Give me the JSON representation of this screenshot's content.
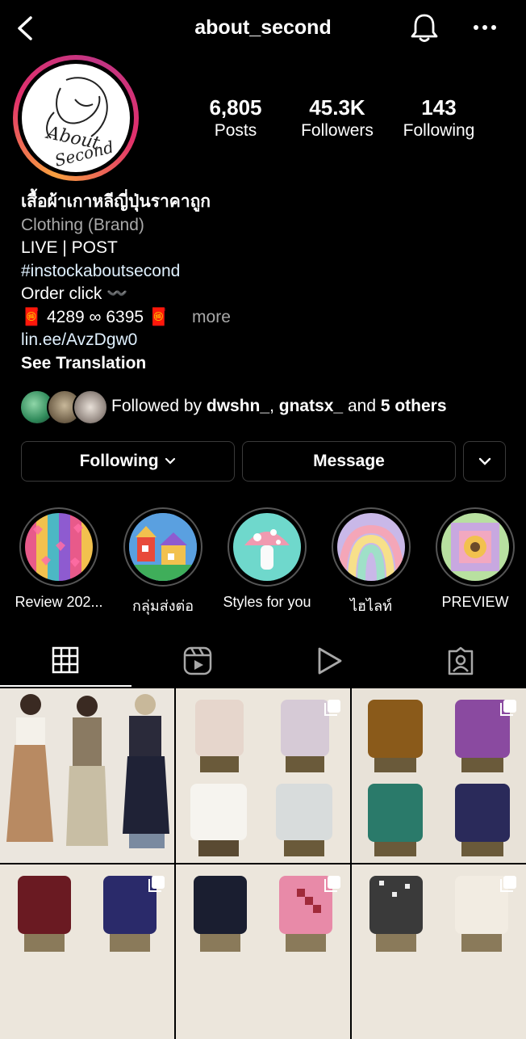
{
  "header": {
    "title": "about_second",
    "back_icon": "chevron-left-icon",
    "bell_icon": "bell-icon",
    "menu_icon": "more-horizontal-icon"
  },
  "avatar": {
    "logo_text": "About Second"
  },
  "stats": [
    {
      "num": "6,805",
      "label": "Posts"
    },
    {
      "num": "45.3K",
      "label": "Followers"
    },
    {
      "num": "143",
      "label": "Following"
    }
  ],
  "bio": {
    "name": "เสื้อผ้าเกาหลีญี่ปุ่นราคาถูก",
    "category": "Clothing (Brand)",
    "line1": "LIVE | POST",
    "hashtag": "#instockaboutsecond",
    "order": "Order click 〰️",
    "phone": "🧧 4289 ∞ 6395 🧧",
    "more": "more",
    "link": "lin.ee/AvzDgw0",
    "see_translation": "See Translation"
  },
  "followed_by": {
    "prefix": "Followed by ",
    "user1": "dwshn_",
    "sep": ", ",
    "user2": "gnatsx_",
    "and": " and ",
    "others": "5 others"
  },
  "buttons": {
    "following": "Following",
    "message": "Message"
  },
  "highlights": [
    {
      "label": "Review 202..."
    },
    {
      "label": "กลุ่มส่งต่อ"
    },
    {
      "label": "Styles for you"
    },
    {
      "label": "ไฮไลท์"
    },
    {
      "label": "PREVIEW"
    }
  ],
  "tabs": [
    "grid-icon",
    "reels-icon",
    "play-icon",
    "tagged-icon"
  ],
  "colors": {
    "background": "#000000",
    "link": "#e0f1ff",
    "muted": "#a8a8a8",
    "border": "#3a3a3a"
  }
}
